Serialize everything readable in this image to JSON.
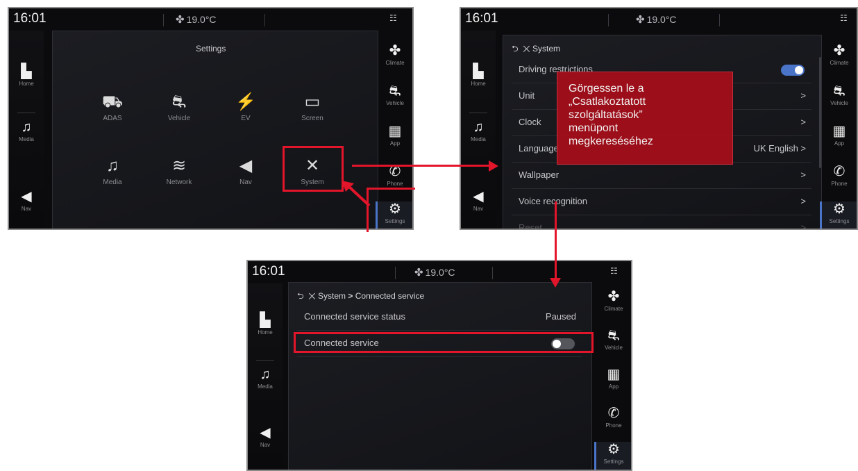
{
  "status": {
    "time": "16:01",
    "temp": "19.0°C",
    "fan_icon": "fan-icon"
  },
  "left_nav": {
    "home": "Home",
    "media": "Media",
    "nav": "Nav"
  },
  "right_nav": {
    "climate": "Climate",
    "vehicle": "Vehicle",
    "app": "App",
    "phone": "Phone",
    "settings": "Settings"
  },
  "screen1": {
    "title": "Settings",
    "tiles": [
      {
        "label": "ADAS",
        "icon": "adas-icon"
      },
      {
        "label": "Vehicle",
        "icon": "vehicle-icon"
      },
      {
        "label": "EV",
        "icon": "ev-icon"
      },
      {
        "label": "Screen",
        "icon": "screen-icon"
      },
      {
        "label": "Media",
        "icon": "media-icon"
      },
      {
        "label": "Network",
        "icon": "network-icon"
      },
      {
        "label": "Nav",
        "icon": "nav-icon"
      },
      {
        "label": "System",
        "icon": "system-icon"
      }
    ]
  },
  "screen2": {
    "header": "System",
    "rows": [
      {
        "label": "Driving restrictions",
        "value": ""
      },
      {
        "label": "Unit",
        "value": ">"
      },
      {
        "label": "Clock",
        "value": ">"
      },
      {
        "label": "Language",
        "value": "UK English >"
      },
      {
        "label": "Wallpaper",
        "value": ">"
      },
      {
        "label": "Voice recognition",
        "value": ">"
      },
      {
        "label": "Reset",
        "value": ">"
      }
    ],
    "driving_restrictions_on": true
  },
  "callout": {
    "line1": "Görgessen le a",
    "line2": "„Csatlakoztatott",
    "line3": "szolgáltatások”",
    "line4": "menüpont",
    "line5": "megkereséséhez"
  },
  "screen3": {
    "breadcrumb_root": "System",
    "breadcrumb_sep": ">",
    "breadcrumb_current": "Connected service",
    "status_label": "Connected service status",
    "status_value": "Paused",
    "toggle_label": "Connected service",
    "connected_service_on": false
  },
  "colors": {
    "highlight": "#e3152a",
    "toggle_on": "#4a74c8",
    "callout_bg": "#a40f1a"
  }
}
